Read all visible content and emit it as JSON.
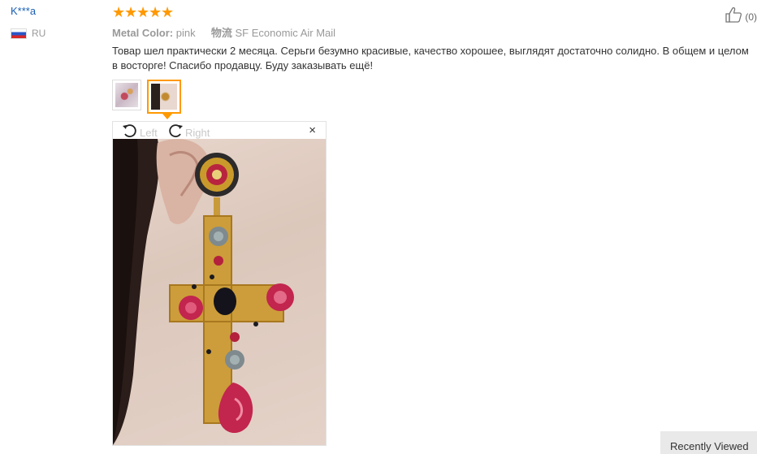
{
  "review": {
    "user": "K***a",
    "country": "RU",
    "rating": 5,
    "attributes": {
      "color_key": "Metal Color:",
      "color_value": "pink",
      "shipping_key": "物流",
      "shipping_value": "SF Economic Air Mail"
    },
    "helpful_count": "(0)",
    "text": "Товар шел практически 2 месяца. Серьги безумно красивые, качество хорошее, выглядят достаточно солидно. В общем и целом в восторге! Спасибо продавцу. Буду заказывать ещё!"
  },
  "viewer": {
    "rotate_left_label": "Left",
    "rotate_right_label": "Right",
    "close_glyph": "×"
  },
  "sidebar": {
    "recently_viewed": "Recently Viewed"
  },
  "colors": {
    "star": "#ff9900",
    "username": "#1a5fb4",
    "active_thumb_border": "#ff9900"
  },
  "icons": [
    "flag-ru-icon",
    "star-icon",
    "thumbs-up-icon",
    "rotate-left-icon",
    "rotate-right-icon",
    "close-icon"
  ]
}
